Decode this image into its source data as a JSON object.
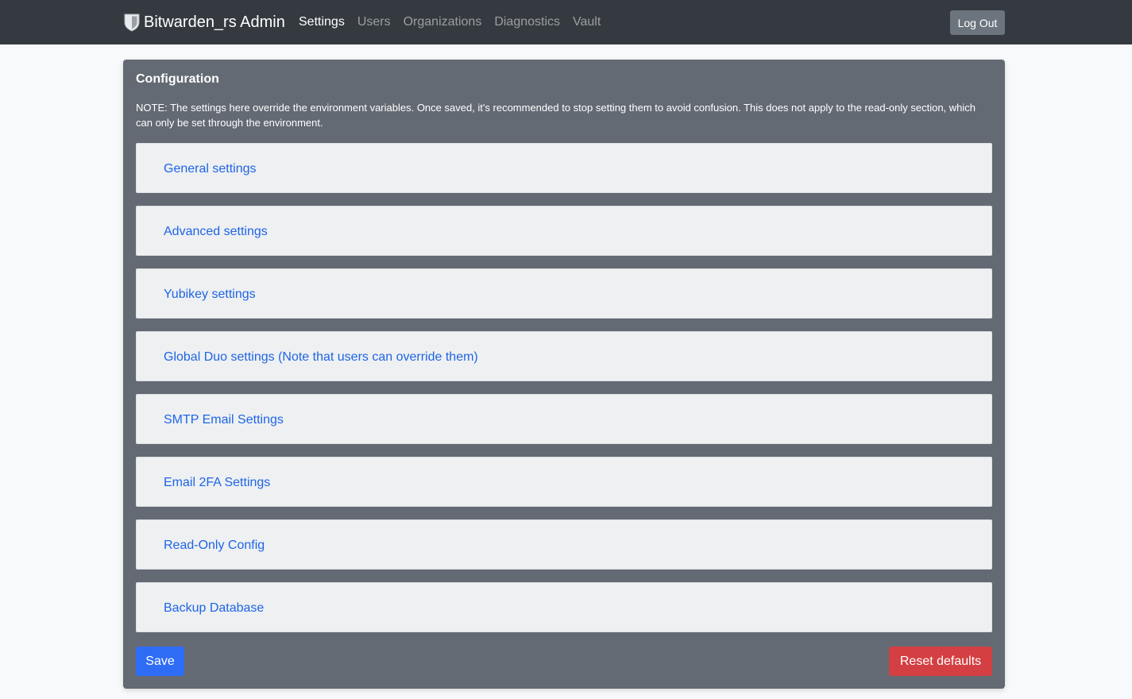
{
  "navbar": {
    "brand": "Bitwarden_rs Admin",
    "brand_icon": "shield-icon",
    "links": [
      "Settings",
      "Users",
      "Organizations",
      "Diagnostics",
      "Vault"
    ],
    "active_link": "Settings",
    "logout_label": "Log Out"
  },
  "config": {
    "title": "Configuration",
    "note": "NOTE: The settings here override the environment variables. Once saved, it's recommended to stop setting them to avoid confusion. This does not apply to the read-only section, which can only be set through the environment.",
    "sections": [
      "General settings",
      "Advanced settings",
      "Yubikey settings",
      "Global Duo settings (Note that users can override them)",
      "SMTP Email Settings",
      "Email 2FA Settings",
      "Read-Only Config",
      "Backup Database"
    ],
    "save_label": "Save",
    "reset_label": "Reset defaults"
  },
  "colors": {
    "navbar_bg": "#343a40",
    "card_bg": "#636a73",
    "link_blue": "#1f65e5",
    "save_blue": "#2f6cf6",
    "reset_red": "#d33f42"
  }
}
